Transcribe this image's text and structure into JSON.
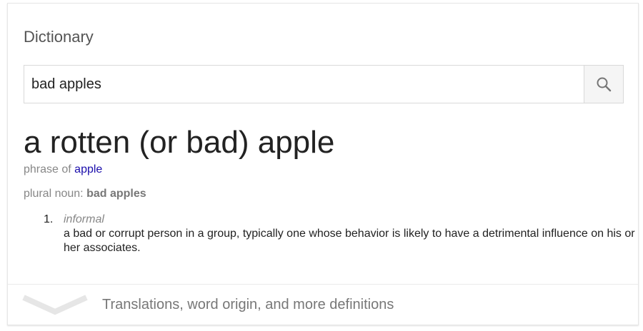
{
  "card": {
    "title": "Dictionary"
  },
  "search": {
    "value": "bad apples",
    "button_icon": "search-icon"
  },
  "entry": {
    "headword": "a rotten (or bad) apple",
    "phrase_prefix": "phrase of",
    "phrase_link": "apple",
    "plural_prefix": "plural noun:",
    "plural_value": "bad apples",
    "definitions": [
      {
        "number": "1.",
        "register": "informal",
        "text": "a bad or corrupt person in a group, typically one whose behavior is likely to have a detrimental influence on his or her associates."
      }
    ]
  },
  "more": {
    "label": "Translations, word origin, and more definitions",
    "icon": "chevron-down-icon"
  },
  "colors": {
    "link": "#1a0dab",
    "muted": "#878787",
    "text": "#222222"
  }
}
